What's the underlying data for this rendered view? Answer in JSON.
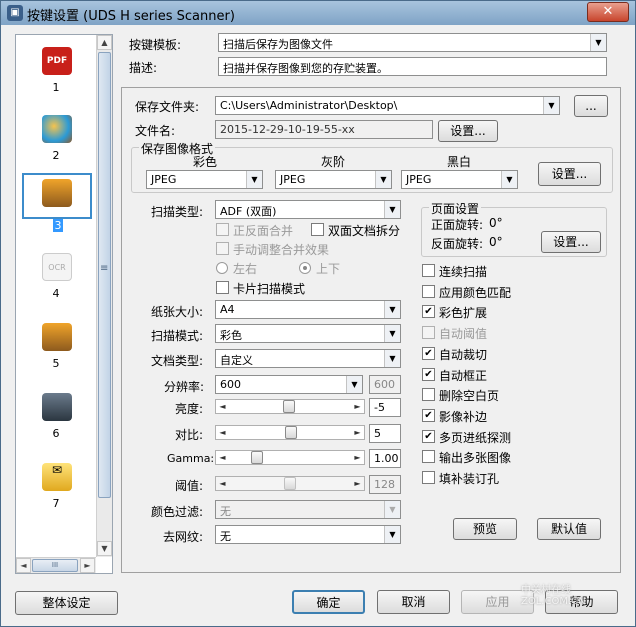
{
  "window": {
    "title": "按键设置 (UDS H series Scanner)",
    "close": "✕"
  },
  "sidebar": {
    "items": [
      {
        "num": "1",
        "icon": "pdf-icon"
      },
      {
        "num": "2",
        "icon": "palette-icon"
      },
      {
        "num": "3",
        "icon": "scanner-icon",
        "selected": true
      },
      {
        "num": "4",
        "icon": "ocr-icon"
      },
      {
        "num": "5",
        "icon": "scanner-icon"
      },
      {
        "num": "6",
        "icon": "printer-icon"
      },
      {
        "num": "7",
        "icon": "email-icon"
      }
    ],
    "scroll_up": "▲",
    "scroll_down": "▼",
    "scroll_left": "◄",
    "scroll_right": "►",
    "grip": "≡",
    "hgrip": "III"
  },
  "template": {
    "label": "按键模板:",
    "value": "扫描后保存为图像文件"
  },
  "description": {
    "label": "描述:",
    "value": "扫描并保存图像到您的存贮装置。"
  },
  "save_folder": {
    "label": "保存文件夹:",
    "value": "C:\\Users\\Administrator\\Desktop\\",
    "browse": "..."
  },
  "file_name": {
    "label": "文件名:",
    "value": "2015-12-29-10-19-55-xx",
    "settings": "设置..."
  },
  "image_format": {
    "title": "保存图像格式",
    "color_label": "彩色",
    "gray_label": "灰阶",
    "bw_label": "黑白",
    "color_value": "JPEG",
    "gray_value": "JPEG",
    "bw_value": "JPEG",
    "settings": "设置..."
  },
  "scan": {
    "type_label": "扫描类型:",
    "type_value": "ADF (双面)",
    "merge_label": "正反面合并",
    "split_label": "双面文档拆分",
    "manual_merge_label": "手动调整合并效果",
    "left_right": "左右",
    "top_bottom": "上下",
    "card_mode": "卡片扫描模式",
    "paper_label": "纸张大小:",
    "paper_value": "A4",
    "mode_label": "扫描模式:",
    "mode_value": "彩色",
    "doctype_label": "文档类型:",
    "doctype_value": "自定义",
    "dpi_label": "分辨率:",
    "dpi_value": "600",
    "dpi_extra": "600",
    "brightness_label": "亮度:",
    "brightness_value": "-5",
    "brightness_level": 0.49,
    "contrast_label": "对比:",
    "contrast_value": "5",
    "contrast_level": 0.51,
    "gamma_label": "Gamma:",
    "gamma_value": "1.00",
    "gamma_level": 0.2,
    "threshold_label": "阈值:",
    "threshold_value": "128",
    "threshold_level": 0.5,
    "color_filter_label": "颜色过滤:",
    "color_filter_value": "无",
    "moire_label": "去网纹:",
    "moire_value": "无"
  },
  "page_settings": {
    "title": "页面设置",
    "front_label": "正面旋转:",
    "front_value": "0°",
    "back_label": "反面旋转:",
    "back_value": "0°",
    "settings": "设置..."
  },
  "options": [
    {
      "label": "连续扫描",
      "checked": false,
      "enabled": true
    },
    {
      "label": "应用颜色匹配",
      "checked": false,
      "enabled": true
    },
    {
      "label": "彩色扩展",
      "checked": true,
      "enabled": true
    },
    {
      "label": "自动阈值",
      "checked": false,
      "enabled": false
    },
    {
      "label": "自动裁切",
      "checked": true,
      "enabled": true
    },
    {
      "label": "自动框正",
      "checked": true,
      "enabled": true
    },
    {
      "label": "删除空白页",
      "checked": false,
      "enabled": true
    },
    {
      "label": "影像补边",
      "checked": true,
      "enabled": true
    },
    {
      "label": "多页进纸探测",
      "checked": true,
      "enabled": true
    },
    {
      "label": "输出多张图像",
      "checked": false,
      "enabled": true
    },
    {
      "label": "填补装订孔",
      "checked": false,
      "enabled": true
    }
  ],
  "buttons": {
    "preview": "预览",
    "default": "默认值",
    "global": "整体设定",
    "ok": "确定",
    "cancel": "取消",
    "apply": "应用",
    "help": "帮助"
  },
  "watermark": "中关村在线 ZOL.COM.CN",
  "check_mark": "✔",
  "dropdown_arrow": "▼",
  "slider_left": "◄",
  "slider_right": "►"
}
